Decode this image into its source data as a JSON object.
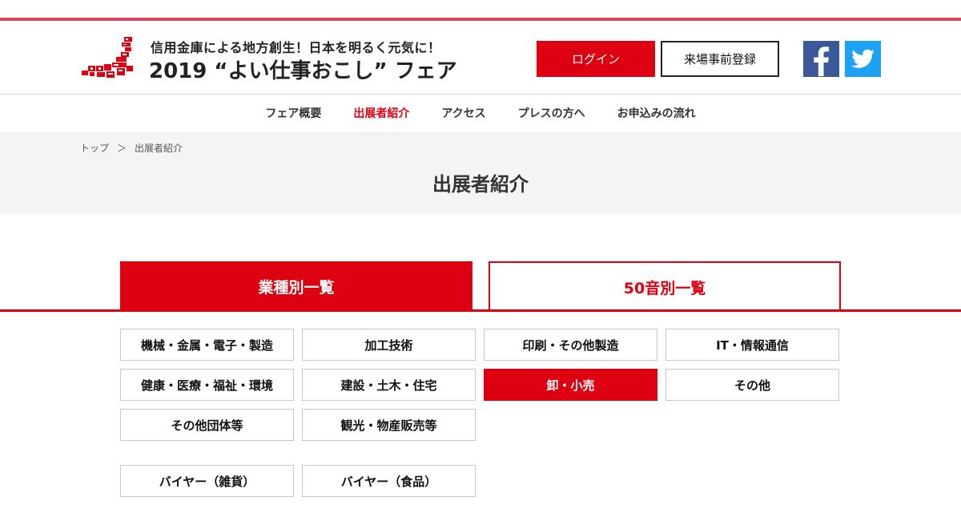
{
  "header": {
    "logo_icon": "japan-map-logo",
    "subtitle": "信用金庫による地方創生！日本を明るく元気に！",
    "title": "2019 “よい仕事おこし” フェア",
    "login_label": "ログイン",
    "register_label": "来場事前登録",
    "facebook_icon": "facebook-icon",
    "twitter_icon": "twitter-icon"
  },
  "nav": {
    "items": [
      {
        "label": "フェア概要",
        "active": false
      },
      {
        "label": "出展者紹介",
        "active": true
      },
      {
        "label": "アクセス",
        "active": false
      },
      {
        "label": "プレスの方へ",
        "active": false
      },
      {
        "label": "お申込みの流れ",
        "active": false
      }
    ]
  },
  "breadcrumb": {
    "home": "トップ",
    "separator": "＞",
    "current": "出展者紹介"
  },
  "page": {
    "title": "出展者紹介"
  },
  "tabs": [
    {
      "label": "業種別一覧",
      "active": true
    },
    {
      "label": "50音別一覧",
      "active": false
    }
  ],
  "categories": [
    {
      "label": "機械・金属・電子・製造",
      "active": false
    },
    {
      "label": "加工技術",
      "active": false
    },
    {
      "label": "印刷・その他製造",
      "active": false
    },
    {
      "label": "IT・情報通信",
      "active": false
    },
    {
      "label": "健康・医療・福祉・環境",
      "active": false
    },
    {
      "label": "建設・土木・住宅",
      "active": false
    },
    {
      "label": "卸・小売",
      "active": true
    },
    {
      "label": "その他",
      "active": false
    },
    {
      "label": "その他団体等",
      "active": false
    },
    {
      "label": "観光・物産販売等",
      "active": false
    },
    {
      "label": "バイヤー（雑貨）",
      "active": false
    },
    {
      "label": "バイヤー（食品）",
      "active": false
    }
  ],
  "colors": {
    "accent": "#dd0010",
    "top_stripe": "#d8485f",
    "facebook": "#3b5998",
    "twitter": "#1da1f2",
    "page_head_bg": "#f4f4f4"
  }
}
